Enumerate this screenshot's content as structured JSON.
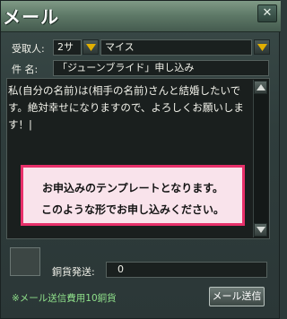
{
  "window": {
    "title": "メール",
    "close_glyph": "✕"
  },
  "recipient": {
    "label": "受取人:",
    "server_value": "2サ",
    "name_value": "マイス"
  },
  "subject": {
    "label": "件 名:",
    "value": "「ジューンブライド」申し込み"
  },
  "message": {
    "body": "私(自分の名前)は(相手の名前)さんと結婚したいです。絶対幸せになりますので、よろしくお願いします！|"
  },
  "notice": {
    "line1": "お申込みのテンプレートとなります。",
    "line2": "このような形でお申し込みください。",
    "border_color": "#e8306a",
    "background_color": "#f9e3eb"
  },
  "coins": {
    "label": "銅貨発送:",
    "value": "0"
  },
  "footer": {
    "fee_note": "※メール送信費用10銅貨",
    "send_label": "メール送信"
  },
  "colors": {
    "dropdown_arrow": "#e2b000",
    "fee_note": "#8fe08a"
  },
  "icons": {
    "dropdown": "chevron-down-icon",
    "scroll_up": "arrow-up-icon",
    "scroll_down": "arrow-down-icon",
    "close": "close-icon"
  }
}
